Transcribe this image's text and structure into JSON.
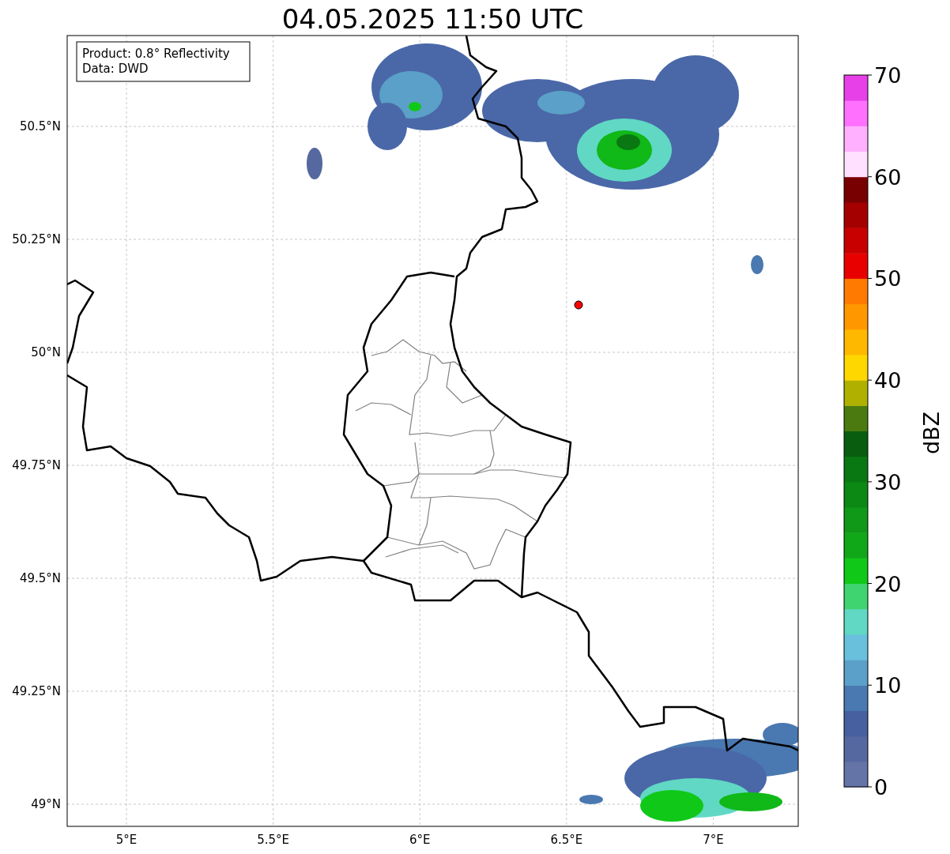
{
  "title": "04.05.2025 11:50 UTC",
  "info_box": {
    "lines": [
      "Product: 0.8° Reflectivity",
      "Data: DWD"
    ]
  },
  "map": {
    "lat_labels": [
      "50.5°N",
      "50.25°N",
      "50°N",
      "49.75°N",
      "49.5°N",
      "49.25°N",
      "49°N"
    ],
    "lon_labels": [
      "5°E",
      "5.5°E",
      "6°E",
      "6.5°E",
      "7°E"
    ]
  },
  "colorbar": {
    "label": "dBZ",
    "ticks": [
      "70",
      "60",
      "50",
      "40",
      "30",
      "20",
      "10",
      "0"
    ],
    "segments": [
      {
        "color": "#6474a6"
      },
      {
        "color": "#5568a0"
      },
      {
        "color": "#4660a0"
      },
      {
        "color": "#4a78b0"
      },
      {
        "color": "#5aa0c8"
      },
      {
        "color": "#68c0dc"
      },
      {
        "color": "#60d8c4"
      },
      {
        "color": "#40d470"
      },
      {
        "color": "#10c818"
      },
      {
        "color": "#10a818"
      },
      {
        "color": "#109818"
      },
      {
        "color": "#0c8814"
      },
      {
        "color": "#0a7812"
      },
      {
        "color": "#085e0e"
      },
      {
        "color": "#4a7a10"
      },
      {
        "color": "#b0b000"
      },
      {
        "color": "#ffd700"
      },
      {
        "color": "#ffb800"
      },
      {
        "color": "#ff9800"
      },
      {
        "color": "#ff7a00"
      },
      {
        "color": "#e80000"
      },
      {
        "color": "#c80000"
      },
      {
        "color": "#a40000"
      },
      {
        "color": "#780000"
      },
      {
        "color": "#ffe0ff"
      },
      {
        "color": "#ffb0ff"
      },
      {
        "color": "#ff70ff"
      },
      {
        "color": "#e840e8"
      }
    ]
  }
}
